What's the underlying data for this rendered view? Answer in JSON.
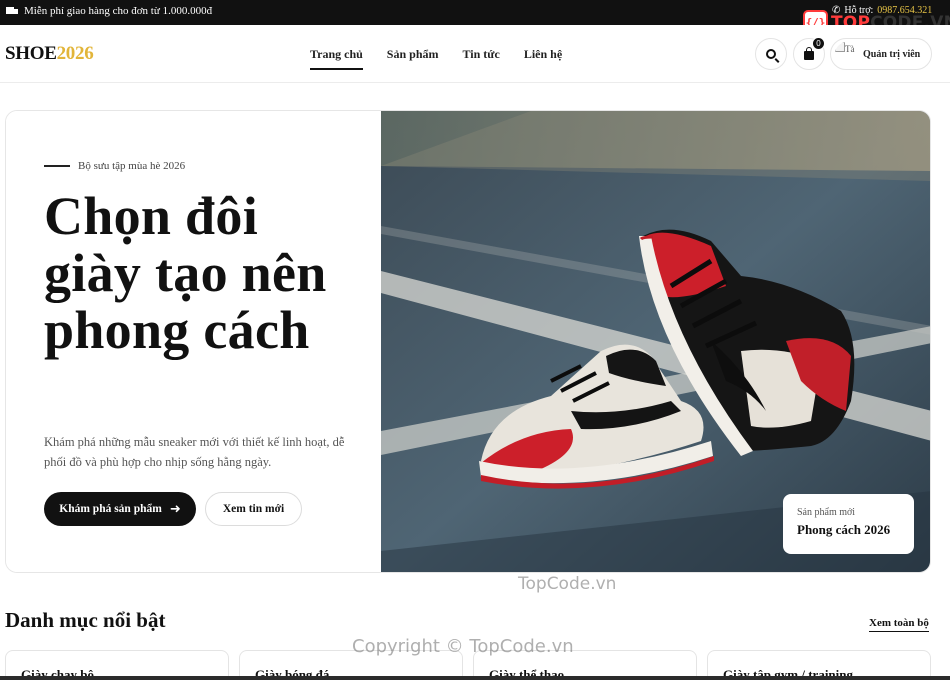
{
  "topbar": {
    "promo": "Miễn phí giao hàng cho đơn từ 1.000.000đ",
    "support_label": "Hỗ trợ:",
    "support_phone": "0987.654.321"
  },
  "watermark_logo": {
    "part1": "TOP",
    "part2": "CODE.VN"
  },
  "header": {
    "logo_main": "SHOE",
    "logo_accent": "2026",
    "nav": [
      "Trang chủ",
      "Sản phẩm",
      "Tin tức",
      "Liên hệ"
    ],
    "active_nav": "Trang chủ",
    "cart_count": "0",
    "avatar_alt": "Tà",
    "user_name": "Quản trị viên"
  },
  "hero": {
    "eyebrow": "Bộ sưu tập mùa hè 2026",
    "headline": "Chọn đôi giày tạo nên phong cách",
    "description": "Khám phá những mẫu sneaker mới với thiết kế linh hoạt, dễ phối đồ và phù hợp cho nhịp sống hằng ngày.",
    "primary_button": "Khám phá sản phẩm",
    "secondary_button": "Xem tin mới",
    "tag_small": "Sản phẩm mới",
    "tag_big": "Phong cách 2026"
  },
  "watermarks": [
    "TopCode.vn",
    "Copyright © TopCode.vn"
  ],
  "featured": {
    "title": "Danh mục nổi bật",
    "see_all": "Xem toàn bộ",
    "categories": [
      "Giày chạy bộ",
      "Giày bóng đá",
      "Giày thể thao",
      "Giày tập gym / training"
    ]
  },
  "colors": {
    "accent": "#e2b53a",
    "primary": "#111111",
    "brand_red": "#ff3b3b"
  }
}
